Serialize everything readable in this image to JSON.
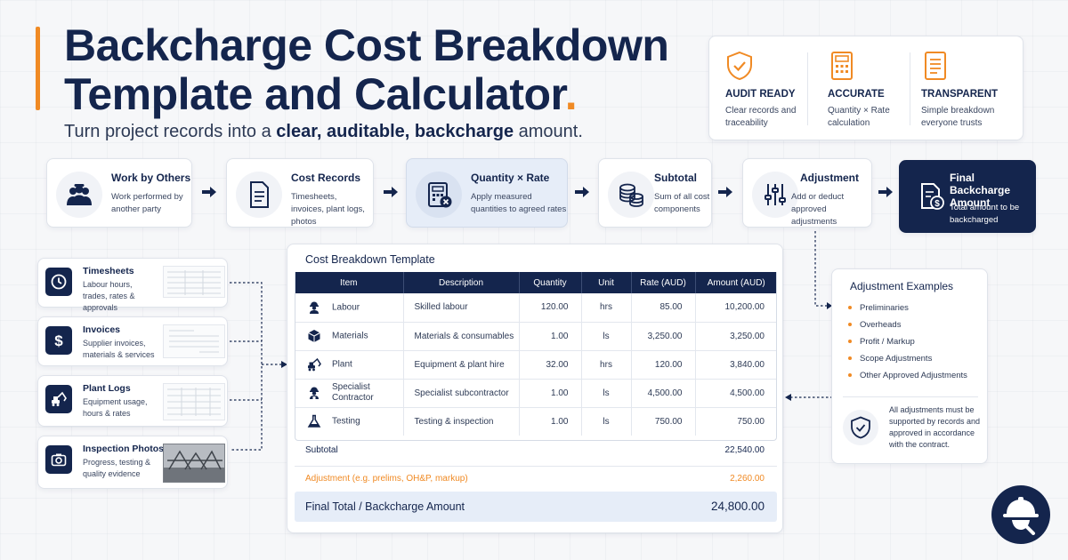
{
  "header": {
    "title_line1": "Backcharge Cost Breakdown",
    "title_line2": "Template and Calculator",
    "title_dot": ".",
    "subtitle_pre": "Turn project records into a ",
    "subtitle_bold": "clear, auditable, backcharge",
    "subtitle_post": " amount."
  },
  "badges": [
    {
      "title": "AUDIT READY",
      "desc": "Clear records and traceability",
      "icon": "shield-check-icon"
    },
    {
      "title": "ACCURATE",
      "desc": "Quantity × Rate calculation",
      "icon": "calculator-icon"
    },
    {
      "title": "TRANSPARENT",
      "desc": "Simple breakdown everyone trusts",
      "icon": "document-icon"
    }
  ],
  "flow": [
    {
      "title": "Work by Others",
      "desc": "Work performed by another party",
      "icon": "workers-icon"
    },
    {
      "title": "Cost Records",
      "desc": "Timesheets, invoices, plant logs, photos",
      "icon": "document-icon"
    },
    {
      "title": "Quantity × Rate",
      "desc": "Apply measured quantities to agreed rates",
      "icon": "calculator-icon"
    },
    {
      "title": "Subtotal",
      "desc": "Sum of all cost components",
      "icon": "coins-icon"
    },
    {
      "title": "Adjustment",
      "desc": "Add or deduct approved adjustments",
      "icon": "sliders-icon"
    },
    {
      "title": "Final Backcharge Amount",
      "desc": "Total amount to be backcharged",
      "icon": "invoice-dollar-icon"
    }
  ],
  "sources": [
    {
      "title": "Timesheets",
      "desc": "Labour hours, trades, rates & approvals",
      "icon": "clock-icon"
    },
    {
      "title": "Invoices",
      "desc": "Supplier invoices, materials & services",
      "icon": "dollar-icon"
    },
    {
      "title": "Plant Logs",
      "desc": "Equipment usage, hours & rates",
      "icon": "excavator-icon"
    },
    {
      "title": "Inspection Photos",
      "desc": "Progress, testing & quality evidence",
      "icon": "camera-icon"
    }
  ],
  "template": {
    "title": "Cost Breakdown Template",
    "headers": [
      "Item",
      "Description",
      "Quantity",
      "Unit",
      "Rate (AUD)",
      "Amount (AUD)"
    ],
    "rows": [
      {
        "item": "Labour",
        "desc": "Skilled labour",
        "qty": "120.00",
        "unit": "hrs",
        "rate": "85.00",
        "amount": "10,200.00",
        "icon": "worker-icon"
      },
      {
        "item": "Materials",
        "desc": "Materials & consumables",
        "qty": "1.00",
        "unit": "ls",
        "rate": "3,250.00",
        "amount": "3,250.00",
        "icon": "box-icon"
      },
      {
        "item": "Plant",
        "desc": "Equipment & plant hire",
        "qty": "32.00",
        "unit": "hrs",
        "rate": "120.00",
        "amount": "3,840.00",
        "icon": "excavator-icon"
      },
      {
        "item": "Specialist Contractor",
        "desc": "Specialist subcontractor",
        "qty": "1.00",
        "unit": "ls",
        "rate": "4,500.00",
        "amount": "4,500.00",
        "icon": "contractor-icon"
      },
      {
        "item": "Testing",
        "desc": "Testing & inspection",
        "qty": "1.00",
        "unit": "ls",
        "rate": "750.00",
        "amount": "750.00",
        "icon": "flask-icon"
      }
    ],
    "subtotal_label": "Subtotal",
    "subtotal_value": "22,540.00",
    "adjustment_label": "Adjustment (e.g. prelims, OH&P, markup)",
    "adjustment_value": "2,260.00",
    "total_label": "Final Total / Backcharge Amount",
    "total_value": "24,800.00"
  },
  "adjustments": {
    "title": "Adjustment Examples",
    "items": [
      "Preliminaries",
      "Overheads",
      "Profit / Markup",
      "Scope Adjustments",
      "Other Approved Adjustments"
    ],
    "note": "All adjustments must be supported by records and approved in accordance with the contract.",
    "note_icon": "shield-check-icon"
  },
  "logo": {
    "icon": "hardhat-logo-icon"
  },
  "colors": {
    "navy": "#14254d",
    "orange": "#f08a24",
    "highlight": "#e6edf8"
  }
}
